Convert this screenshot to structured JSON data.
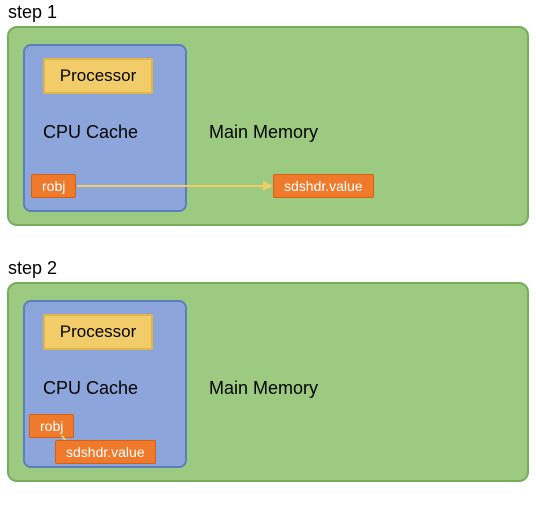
{
  "step1": {
    "label": "step 1",
    "processor": "Processor",
    "cpu_cache": "CPU Cache",
    "main_memory": "Main Memory",
    "robj": "robj",
    "sdshdr": "sdshdr.value"
  },
  "step2": {
    "label": "step 2",
    "processor": "Processor",
    "cpu_cache": "CPU Cache",
    "main_memory": "Main Memory",
    "robj": "robj",
    "sdshdr": "sdshdr.value"
  },
  "colors": {
    "outer_bg": "#9cca81",
    "outer_border": "#77ad5a",
    "cache_bg": "#8ca5da",
    "cache_border": "#5b7ec0",
    "processor_bg": "#f2cc68",
    "processor_border": "#e0b648",
    "orange_bg": "#f07a2c",
    "orange_border": "#d85f12",
    "arrow": "#f2cc68"
  }
}
